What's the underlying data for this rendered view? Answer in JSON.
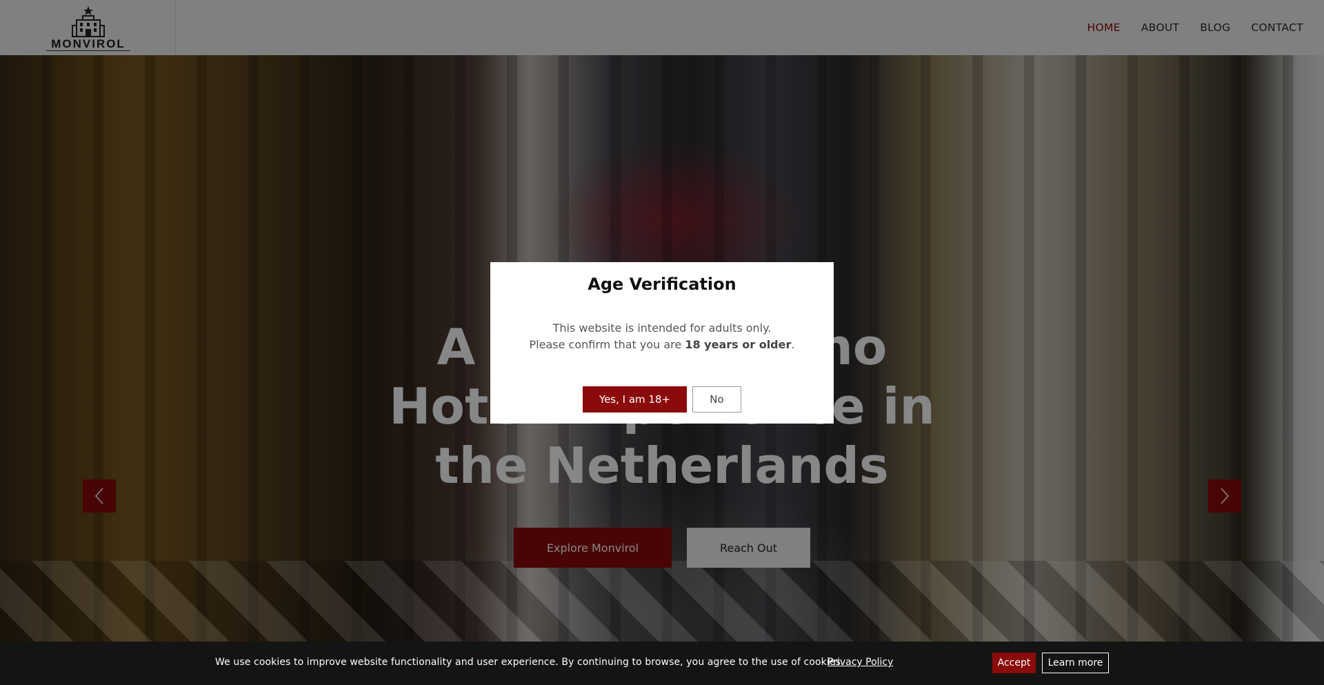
{
  "header": {
    "logo_text": "MONVIROL",
    "nav": {
      "home": "HOME",
      "about": "ABOUT",
      "blog": "BLOG",
      "contact": "CONTACT"
    }
  },
  "hero": {
    "title": "A Luxury Casino Hotel Experience in the Netherlands",
    "explore_label": "Explore Monvirol",
    "reach_label": "Reach Out"
  },
  "modal": {
    "title": "Age Verification",
    "line1": "This website is intended for adults only.",
    "line2_prefix": "Please confirm that you are ",
    "line2_bold": "18 years or older",
    "line2_suffix": ".",
    "yes_label": "Yes, I am 18+",
    "no_label": "No"
  },
  "cookie": {
    "text": "We use cookies to improve website functionality and user experience. By continuing to browse, you agree to the use of cookies.",
    "privacy_label": "Privacy Policy",
    "accept_label": "Accept",
    "learn_label": "Learn more"
  },
  "colors": {
    "accent": "#8b0a0a",
    "header_bg": "#f2f2f2",
    "cookie_bg": "#141414"
  }
}
